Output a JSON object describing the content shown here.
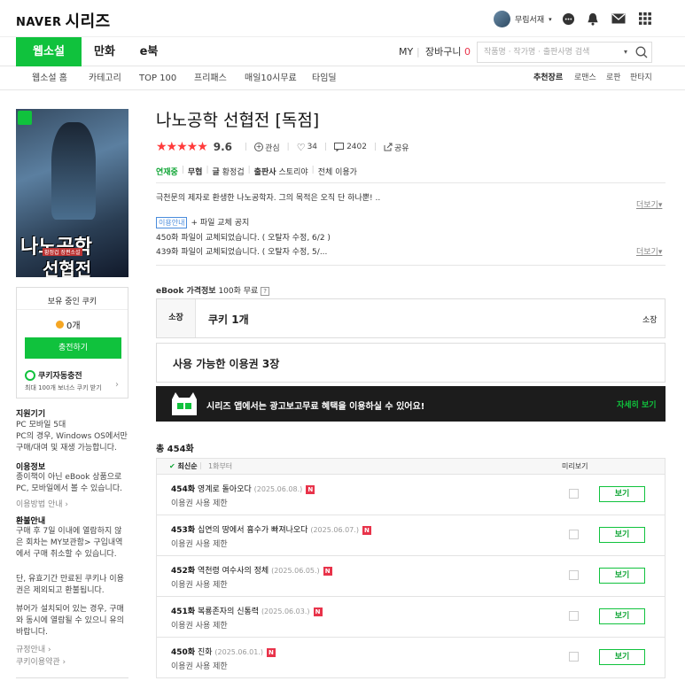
{
  "header": {
    "brand": "NAVER",
    "service": "시리즈",
    "username": "무림서재"
  },
  "nav": {
    "tabs": [
      "웹소설",
      "만화",
      "e북"
    ],
    "my": "MY",
    "cart": "장바구니",
    "cart_count": "0",
    "search_placeholder": "작품명 · 작가명 · 출판사명 검색"
  },
  "subnav": {
    "items": [
      "웹소설 홈",
      "카테고리",
      "TOP 100",
      "프리패스",
      "매일10시무료",
      "타임딜"
    ],
    "genres": [
      "추천장르",
      "로맨스",
      "로판",
      "판타지"
    ]
  },
  "side": {
    "cover_title_1": "나노공학",
    "cover_title_2": "선협전",
    "cover_pub": "황정겁 장편소설",
    "cookie_label": "보유 중인 쿠키",
    "cookie_count": "0개",
    "charge_button": "충전하기",
    "auto_charge_title": "쿠키자동충전",
    "auto_charge_desc": "최대 100개 보너스 쿠키 받기",
    "device_h": "지원기기",
    "device_1": "PC  모바일 5대",
    "device_2": "PC의 경우, Windows OS에서만 구매/대여 및 재생 가능합니다.",
    "use_h": "이용정보",
    "use_1": "종이책이 아닌 eBook 상품으로 PC, 모바일에서 볼 수 있습니다.",
    "use_link": "이용방법 안내",
    "refund_h": "환불안내",
    "refund_1": "구매 후 7일 이내에 열람하지 않은 회차는 MY보관함> 구입내역에서 구매 취소할 수 있습니다.",
    "refund_2": "단, 유효기간 만료된 쿠키나 이용권은 제외되고 환불됩니다.",
    "refund_3": "뷰어가 설치되어 있는 경우, 구매와 동시에 열람될 수 있으니 유의 바랍니다.",
    "link_rules": "규정안내",
    "link_cookie_terms": "쿠키이용약관"
  },
  "main": {
    "title": "나노공학 선협전 [독점]",
    "rating": "9.6",
    "interest": "관심",
    "likes": "34",
    "comments": "2402",
    "share": "공유",
    "status": "연재중",
    "free_label": "무협",
    "author_label": "글",
    "author": "황정겁",
    "publisher_label": "출판사",
    "publisher": "스토리야",
    "age": "전체 이용가",
    "synopsis": "극천문의 제자로 환생한 나노공학자. 그의 목적은 오직 단 하나뿐! ..",
    "more": "더보기",
    "notice_badge": "이용안내",
    "notice_title": "+ 파일 교체 공지",
    "notice_1": "450화 파일이 교체되었습니다. ( 오탈자 수정, 6/2 )",
    "notice_2": "439화 파일이 교체되었습니다. ( 오탈자 수정, 5/...",
    "price_h": "eBook 가격정보",
    "price_free": "100화 무료",
    "own_label": "소장",
    "own_cookie": "쿠키 1개",
    "own_right": "소장",
    "ticket_text": "사용 가능한 이용권 3장",
    "banner_text": "시리즈 앱에서는 광고보고무료 혜택을 이용하실 수 있어요!",
    "banner_link": "자세히 보기",
    "total": "총 454화",
    "sort_latest": "최신순",
    "sort_first": "1화부터",
    "preview_h": "미리보기",
    "view_label": "보기",
    "restrict": "이용권 사용 제한",
    "episodes": [
      {
        "no": "454화",
        "title": "영계로 돌아오다",
        "date": "(2025.06.08.)"
      },
      {
        "no": "453화",
        "title": "십연의 땅에서 흉수가 빠져나오다",
        "date": "(2025.06.07.)"
      },
      {
        "no": "452화",
        "title": "역천령 여수사의 정체",
        "date": "(2025.06.05.)"
      },
      {
        "no": "451화",
        "title": "복룡존자의 신통력",
        "date": "(2025.06.03.)"
      },
      {
        "no": "450화",
        "title": "진화",
        "date": "(2025.06.01.)"
      }
    ]
  }
}
